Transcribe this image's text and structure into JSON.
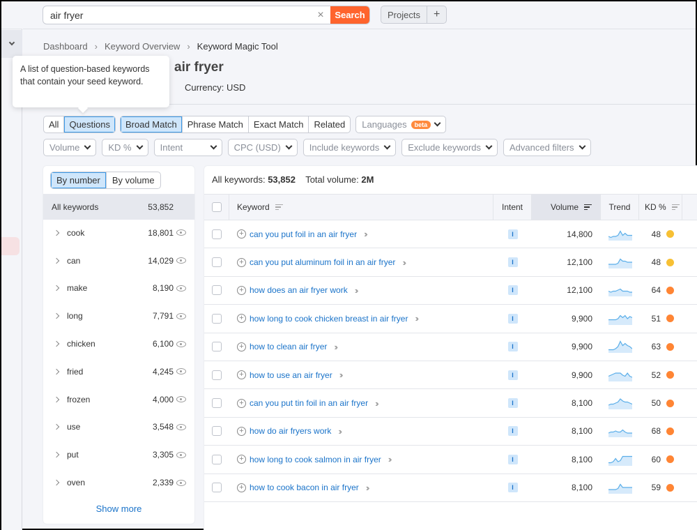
{
  "topbar": {
    "search_value": "air fryer",
    "search_button": "Search",
    "clear_icon": "×",
    "projects_label": "Projects",
    "add_label": "+"
  },
  "breadcrumb": [
    "Dashboard",
    "Keyword Overview",
    "Keyword Magic Tool"
  ],
  "header": {
    "title": "air fryer",
    "currency": "Currency: USD"
  },
  "tooltip": {
    "text": "A list of question-based keywords that contain your seed keyword."
  },
  "question_tabs": [
    "All",
    "Questions"
  ],
  "question_tabs_active": "Questions",
  "match_tabs": [
    "Broad Match",
    "Phrase Match",
    "Exact Match",
    "Related"
  ],
  "match_tabs_active": "Broad Match",
  "languages": {
    "label": "Languages",
    "badge": "beta"
  },
  "filters": [
    "Volume",
    "KD %",
    "Intent",
    "CPC (USD)",
    "Include keywords",
    "Exclude keywords",
    "Advanced filters"
  ],
  "groups_panel": {
    "toggle": [
      "By number",
      "By volume"
    ],
    "toggle_active": "By number",
    "all_label": "All keywords",
    "all_count": "53,852",
    "items": [
      {
        "label": "cook",
        "count": "18,801"
      },
      {
        "label": "can",
        "count": "14,029"
      },
      {
        "label": "make",
        "count": "8,190"
      },
      {
        "label": "long",
        "count": "7,791"
      },
      {
        "label": "chicken",
        "count": "6,100"
      },
      {
        "label": "fried",
        "count": "4,245"
      },
      {
        "label": "frozen",
        "count": "4,000"
      },
      {
        "label": "use",
        "count": "3,548"
      },
      {
        "label": "put",
        "count": "3,305"
      },
      {
        "label": "oven",
        "count": "2,339"
      }
    ],
    "show_more": "Show more"
  },
  "summary": {
    "all_label": "All keywords:",
    "all_value": "53,852",
    "volume_label": "Total volume:",
    "volume_value": "2M"
  },
  "table": {
    "columns": [
      "Keyword",
      "Intent",
      "Volume",
      "Trend",
      "KD %"
    ],
    "kd_colors": {
      "medium": "#f7c034",
      "hard": "#ff8534"
    },
    "rows": [
      {
        "keyword": "can you put foil in an air fryer",
        "intent": "I",
        "volume": "14,800",
        "kd": "48",
        "kd_level": "medium",
        "trend": [
          4,
          3,
          4,
          4,
          5,
          9,
          5,
          7,
          5,
          5,
          5
        ]
      },
      {
        "keyword": "can you put aluminum foil in an air fryer",
        "intent": "I",
        "volume": "12,100",
        "kd": "48",
        "kd_level": "medium",
        "trend": [
          4,
          4,
          4,
          4,
          5,
          9,
          7,
          7,
          6,
          6,
          6
        ]
      },
      {
        "keyword": "how does an air fryer work",
        "intent": "I",
        "volume": "12,100",
        "kd": "64",
        "kd_level": "hard",
        "trend": [
          5,
          4,
          5,
          5,
          6,
          7,
          5,
          5,
          5,
          4,
          4
        ]
      },
      {
        "keyword": "how long to cook chicken breast in air fryer",
        "intent": "I",
        "volume": "9,900",
        "kd": "51",
        "kd_level": "hard",
        "trend": [
          5,
          5,
          5,
          5,
          6,
          9,
          7,
          9,
          6,
          8,
          7
        ]
      },
      {
        "keyword": "how to clean air fryer",
        "intent": "I",
        "volume": "9,900",
        "kd": "63",
        "kd_level": "hard",
        "trend": [
          3,
          3,
          3,
          4,
          6,
          11,
          7,
          9,
          7,
          6,
          4
        ]
      },
      {
        "keyword": "how to use an air fryer",
        "intent": "I",
        "volume": "9,900",
        "kd": "52",
        "kd_level": "hard",
        "trend": [
          5,
          6,
          7,
          8,
          8,
          8,
          6,
          5,
          8,
          5,
          4
        ]
      },
      {
        "keyword": "can you put tin foil in an air fryer",
        "intent": "I",
        "volume": "8,100",
        "kd": "50",
        "kd_level": "hard",
        "trend": [
          4,
          5,
          5,
          6,
          7,
          10,
          8,
          7,
          7,
          6,
          5
        ]
      },
      {
        "keyword": "how do air fryers work",
        "intent": "I",
        "volume": "8,100",
        "kd": "68",
        "kd_level": "hard",
        "trend": [
          4,
          5,
          5,
          6,
          5,
          5,
          7,
          5,
          4,
          4,
          4
        ]
      },
      {
        "keyword": "how long to cook salmon in air fryer",
        "intent": "I",
        "volume": "8,100",
        "kd": "60",
        "kd_level": "hard",
        "trend": [
          3,
          3,
          4,
          7,
          4,
          5,
          9,
          9,
          9,
          9,
          9
        ]
      },
      {
        "keyword": "how to cook bacon in air fryer",
        "intent": "I",
        "volume": "8,100",
        "kd": "59",
        "kd_level": "hard",
        "trend": [
          4,
          4,
          4,
          4,
          5,
          9,
          6,
          6,
          6,
          6,
          6
        ]
      }
    ]
  }
}
